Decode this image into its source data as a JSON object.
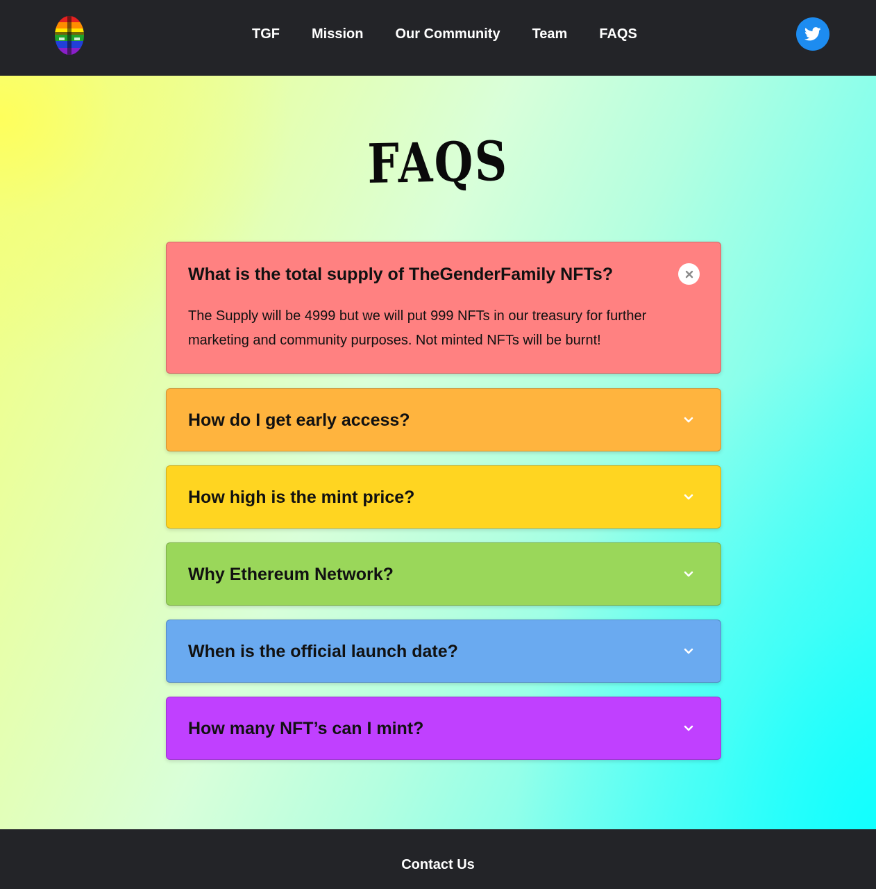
{
  "header": {
    "logo_icon": "rainbow-face-logo-icon",
    "nav": [
      "TGF",
      "Mission",
      "Our Community",
      "Team",
      "FAQS"
    ],
    "twitter_icon": "twitter-bird-icon",
    "twitter_color": "#1d8cf0"
  },
  "main": {
    "title": "FAQS",
    "faqs": [
      {
        "question": "What is the total supply of TheGenderFamily NFTs?",
        "answer": "The Supply will be 4999 but we will put 999 NFTs in our treasury for further marketing and community purposes. Not minted NFTs will be burnt!",
        "expanded": true,
        "color": "#ff8181",
        "icon": "close-icon"
      },
      {
        "question": "How do I get early access?",
        "expanded": false,
        "color": "#ffb43e",
        "icon": "chevron-down-icon"
      },
      {
        "question": "How high is the mint price?",
        "expanded": false,
        "color": "#ffd521",
        "icon": "chevron-down-icon"
      },
      {
        "question": "Why Ethereum Network?",
        "expanded": false,
        "color": "#9ad75a",
        "icon": "chevron-down-icon"
      },
      {
        "question": "When is the official launch date?",
        "expanded": false,
        "color": "#6aaaf0",
        "icon": "chevron-down-icon"
      },
      {
        "question": "How many NFT’s can I mint?",
        "expanded": false,
        "color": "#c040ff",
        "icon": "chevron-down-icon"
      }
    ]
  },
  "footer": {
    "contact": "Contact Us"
  }
}
